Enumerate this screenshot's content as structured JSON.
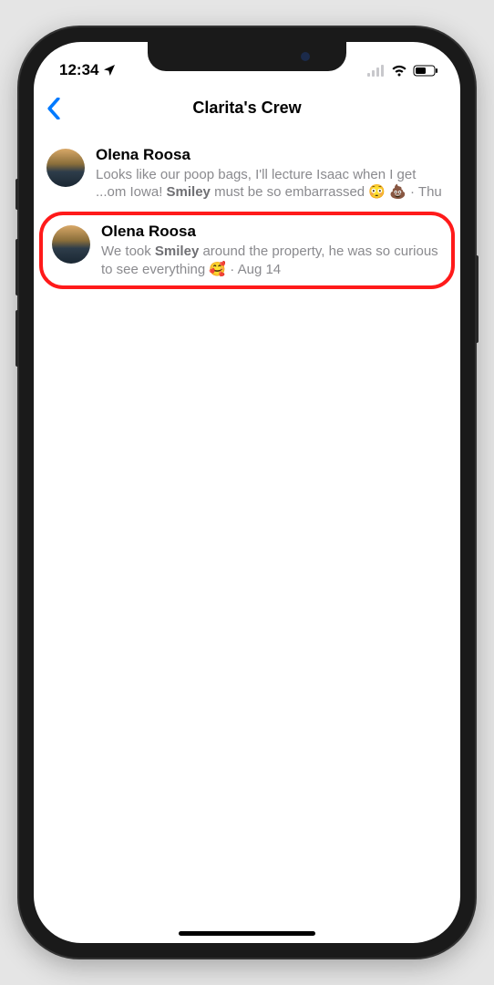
{
  "status": {
    "time": "12:34",
    "location_icon": "location-arrow"
  },
  "header": {
    "title": "Clarita's Crew"
  },
  "results": [
    {
      "name": "Olena Roosa",
      "line1_pre": "Looks like our poop bags, I'll lecture Isaac when I get ...om Iowa! ",
      "bold1": "Smiley",
      "line1_post": " must be so embarrassed 😳 💩",
      "time": "Thu",
      "highlight": false
    },
    {
      "name": "Olena Roosa",
      "line1_pre": "We took ",
      "bold1": "Smiley",
      "line1_post": " around the property, he was so curious to see everything 🥰",
      "time": "Aug 14",
      "highlight": true
    }
  ]
}
